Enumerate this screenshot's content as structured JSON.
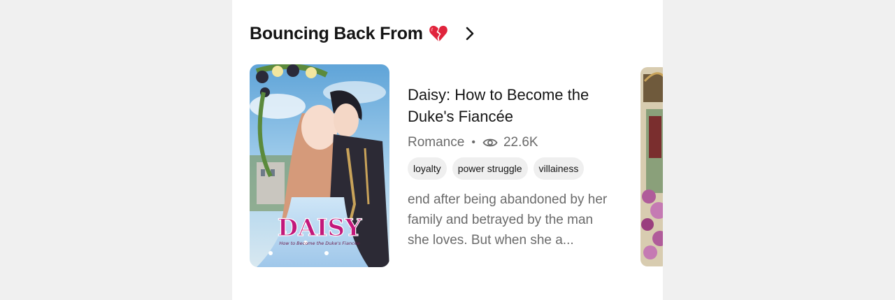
{
  "section": {
    "title": "Bouncing Back From",
    "heart_icon": "broken-heart-icon",
    "chevron_icon": "chevron-right-icon"
  },
  "book": {
    "title": "Daisy: How to Become the Duke's Fiancée",
    "genre": "Romance",
    "views": "22.6K",
    "view_icon": "eye-icon",
    "tags": [
      "loyalty",
      "power struggle",
      "villainess"
    ],
    "description": "end after being abandoned by her family and betrayed by the man she loves. But when she a...",
    "cover_logo": "DAISY",
    "cover_subtitle": "How to Become the Duke's Fiancée"
  },
  "colors": {
    "background": "#f0f0f0",
    "panel": "#ffffff",
    "title_text": "#141414",
    "muted_text": "#6b6b6b",
    "tag_bg": "#efefef",
    "logo_pink": "#c2187a"
  }
}
